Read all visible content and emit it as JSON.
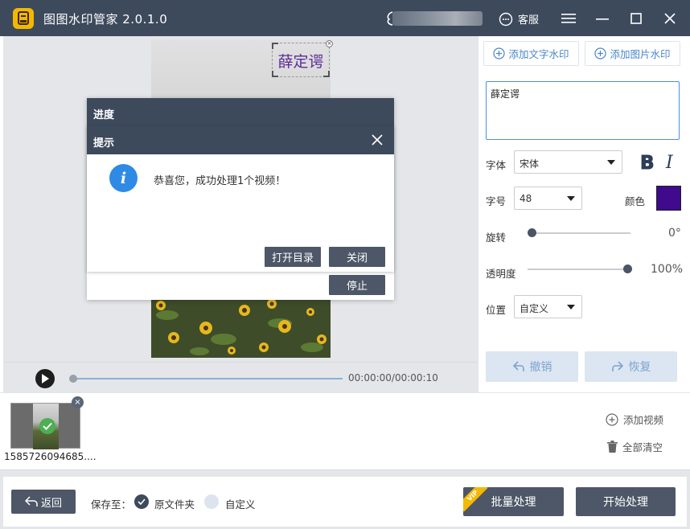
{
  "app": {
    "title": "图图水印管家  2.0.1.0",
    "service_label": "客服"
  },
  "preview": {
    "watermark_text": "薛定谔"
  },
  "player": {
    "time": "00:00:00/00:00:10"
  },
  "panel": {
    "add_text_watermark": "添加文字水印",
    "add_image_watermark": "添加图片水印",
    "watermark_input_value": "薛定谔",
    "font_label": "字体",
    "font_value": "宋体",
    "bold_label": "B",
    "italic_label": "I",
    "size_label": "字号",
    "size_value": "48",
    "color_label": "颜色",
    "color_value": "#3f0a8c",
    "rotation_label": "旋转",
    "rotation_value": "0°",
    "rotation_level": 0,
    "opacity_label": "透明度",
    "opacity_value": "100%",
    "opacity_level": 1.0,
    "position_label": "位置",
    "position_value": "自定义",
    "undo_label": "撤销",
    "redo_label": "恢复"
  },
  "files": {
    "items": [
      {
        "name": "1585726094685...."
      }
    ],
    "add_video_label": "添加视频",
    "clear_all_label": "全部清空"
  },
  "bottom": {
    "back_label": "返回",
    "save_to_label": "保存至：",
    "option_original": "原文件夹",
    "option_custom": "自定义",
    "batch_label": "批量处理",
    "vip_label": "VIP",
    "start_label": "开始处理"
  },
  "progress_dialog": {
    "title": "进度",
    "stop_label": "停止"
  },
  "prompt_dialog": {
    "title": "提示",
    "message": "恭喜您，成功处理1个视频！",
    "open_dir_label": "打开目录",
    "close_label": "关闭"
  },
  "colors": {
    "titlebar": "#3d4a5c",
    "accent_blue": "#2f8ae5",
    "button_dark": "#4d5767",
    "watermark_purple": "#5b2c9a"
  }
}
